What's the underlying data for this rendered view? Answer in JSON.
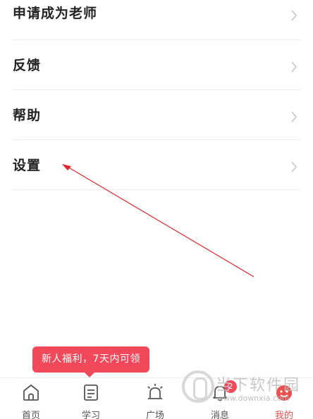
{
  "menu": {
    "items": [
      {
        "label": "申请成为老师"
      },
      {
        "label": "反馈"
      },
      {
        "label": "帮助"
      },
      {
        "label": "设置"
      }
    ],
    "chevron_icon": "chevron-right-icon"
  },
  "promo": {
    "text": "新人福利，7天内可领"
  },
  "tabbar": {
    "tabs": [
      {
        "label": "首页",
        "icon": "home-icon"
      },
      {
        "label": "学习",
        "icon": "study-book-icon"
      },
      {
        "label": "广场",
        "icon": "plaza-alarm-icon"
      },
      {
        "label": "消息",
        "icon": "bell-icon",
        "badge": "2"
      },
      {
        "label": "我的",
        "icon": "profile-face-icon",
        "active": true
      }
    ]
  },
  "watermark": {
    "title": "当下软件园",
    "url": "www.downxia.com"
  },
  "colors": {
    "accent": "#e9504f",
    "promo": "#f2495a",
    "arrow": "#e0262a",
    "divider": "#ececec"
  }
}
